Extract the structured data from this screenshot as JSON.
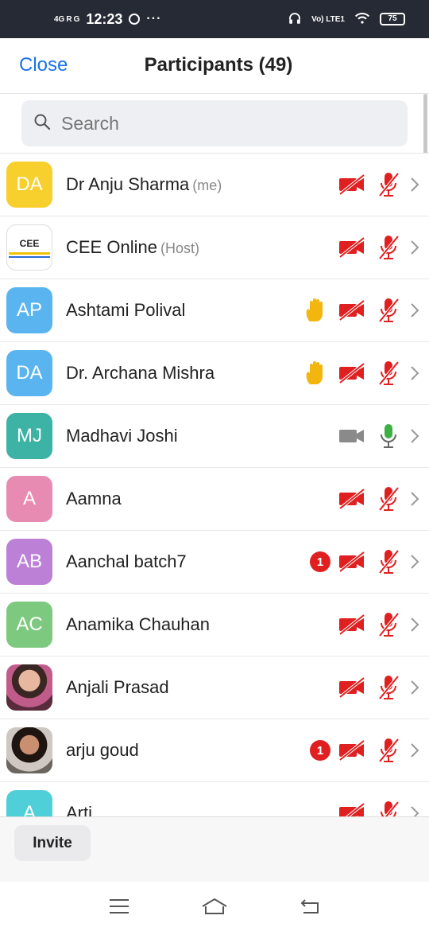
{
  "status_bar": {
    "signal1": "4G",
    "signal2": "R",
    "signal3": "G",
    "time": "12:23",
    "dots": "···",
    "volte": "Vo) LTE1",
    "battery": "75"
  },
  "header": {
    "close_label": "Close",
    "title": "Participants (49)"
  },
  "search": {
    "placeholder": "Search"
  },
  "participants": [
    {
      "initials": "DA",
      "name": "Dr Anju Sharma",
      "role": "(me)",
      "avatar_color": "#f7d02e",
      "video": "off",
      "audio": "off"
    },
    {
      "initials": "CEE",
      "name": "CEE Online",
      "role": "(Host)",
      "avatar_type": "logo",
      "video": "off",
      "audio": "off"
    },
    {
      "initials": "AP",
      "name": "Ashtami Polival",
      "role": "",
      "avatar_color": "#5ab4f0",
      "raised_hand": true,
      "video": "off",
      "audio": "off"
    },
    {
      "initials": "DA",
      "name": "Dr. Archana Mishra",
      "role": "",
      "avatar_color": "#5ab4f0",
      "raised_hand": true,
      "video": "off",
      "audio": "off"
    },
    {
      "initials": "MJ",
      "name": "Madhavi Joshi",
      "role": "",
      "avatar_color": "#3cb3a4",
      "video": "on",
      "audio": "on"
    },
    {
      "initials": "A",
      "name": "Aamna",
      "role": "",
      "avatar_color": "#e88bb2",
      "video": "off",
      "audio": "off"
    },
    {
      "initials": "AB",
      "name": "Aanchal batch7",
      "role": "",
      "avatar_color": "#bc80d6",
      "unread": "1",
      "video": "off",
      "audio": "off"
    },
    {
      "initials": "AC",
      "name": "Anamika Chauhan",
      "role": "",
      "avatar_color": "#7dc97f",
      "video": "off",
      "audio": "off"
    },
    {
      "initials": "",
      "name": "Anjali Prasad",
      "role": "",
      "avatar_type": "photo1",
      "video": "off",
      "audio": "off"
    },
    {
      "initials": "",
      "name": "arju goud",
      "role": "",
      "avatar_type": "photo2",
      "unread": "1",
      "video": "off",
      "audio": "off"
    },
    {
      "initials": "A",
      "name": "Arti",
      "role": "",
      "avatar_color": "#4fcfd8",
      "video": "off",
      "audio": "off"
    }
  ],
  "footer": {
    "invite_label": "Invite"
  },
  "colors": {
    "accent": "#1a73e8",
    "muted_red": "#e02020",
    "unmuted_green": "#3cb043",
    "hand_yellow": "#f2b60f"
  },
  "icons": {
    "video_off": "video-off-icon",
    "video_on": "video-on-icon",
    "mic_off": "mic-off-icon",
    "mic_on": "mic-on-icon",
    "hand": "raised-hand-icon",
    "chevron": "chevron-right-icon",
    "search": "search-icon"
  }
}
